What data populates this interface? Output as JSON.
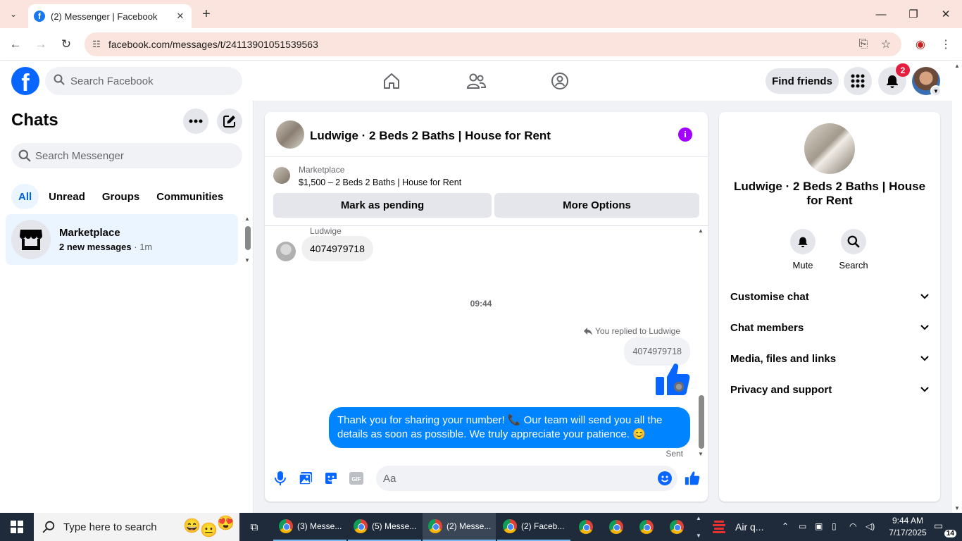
{
  "browser": {
    "tab_title": "(2) Messenger | Facebook",
    "url": "facebook.com/messages/t/24113901051539563"
  },
  "fb_header": {
    "search_placeholder": "Search Facebook",
    "find_friends": "Find friends",
    "notification_count": "2"
  },
  "sidebar": {
    "title": "Chats",
    "search_placeholder": "Search Messenger",
    "filters": [
      "All",
      "Unread",
      "Groups",
      "Communities"
    ],
    "active_filter": "All",
    "chats": [
      {
        "name": "Marketplace",
        "preview": "2 new messages",
        "time": "· 1m"
      }
    ]
  },
  "conversation": {
    "title": "Ludwige · 2 Beds 2 Baths | House for Rent",
    "marketplace": {
      "label": "Marketplace",
      "listing": "$1,500 – 2 Beds 2 Baths | House for Rent",
      "mark_pending": "Mark as pending",
      "more_options": "More Options"
    },
    "messages": {
      "sender_name": "Ludwige",
      "received_text": "4074979718",
      "timestamp": "09:44",
      "replied_label": "You replied to Ludwige",
      "quoted_text": "4074979718",
      "sent_text": "Thank you for sharing your number! 📞 Our team will send you all the details as soon as possible. We truly appreciate your patience. 😊",
      "status": "Sent"
    },
    "composer_placeholder": "Aa"
  },
  "info_panel": {
    "name": "Ludwige · 2 Beds 2 Baths | House for Rent",
    "actions": [
      "Mute",
      "Search"
    ],
    "sections": [
      "Customise chat",
      "Chat members",
      "Media, files and links",
      "Privacy and support"
    ]
  },
  "taskbar": {
    "search_placeholder": "Type here to search",
    "apps": [
      {
        "label": "(3) Messe..."
      },
      {
        "label": "(5) Messe..."
      },
      {
        "label": "(2) Messe..."
      },
      {
        "label": "(2) Faceb..."
      }
    ],
    "weather": "Air q...",
    "time": "9:44 AM",
    "date": "7/17/2025",
    "notifications": "14"
  },
  "colors": {
    "brand": "#0866ff",
    "sent_bubble": "#0084ff",
    "info_icon": "#a200ff",
    "badge": "#e41e3f"
  }
}
